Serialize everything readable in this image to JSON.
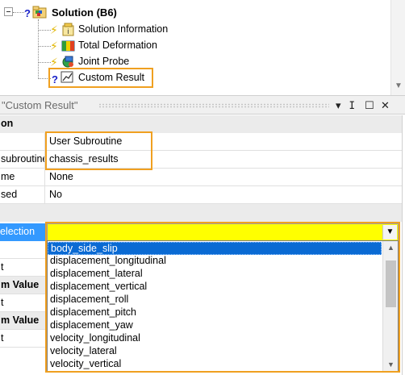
{
  "tree": {
    "root_label": "Solution (B6)",
    "status_mark": "?",
    "children": [
      {
        "label": "Solution Information",
        "icon": "solution-information-icon"
      },
      {
        "label": "Total Deformation",
        "icon": "deformation-result-icon"
      },
      {
        "label": "Joint Probe",
        "icon": "probe-icon"
      },
      {
        "label": "Custom Result",
        "icon": "custom-result-icon"
      }
    ]
  },
  "details": {
    "title": "\"Custom Result\"",
    "header_icons": {
      "dropdown": "▾",
      "pin": "ⵊ",
      "maximize": "☐",
      "close": "✕"
    },
    "rows": [
      {
        "key": "on",
        "value": "",
        "group": true
      },
      {
        "key": "",
        "value": "User Subroutine"
      },
      {
        "key": "subroutine",
        "value": "chassis_results"
      },
      {
        "key": "me",
        "value": "None"
      },
      {
        "key": "sed",
        "value": "No"
      },
      {
        "key": "",
        "value": "",
        "group": true
      }
    ],
    "selection_key": "election",
    "selection_value": "",
    "under_rows": [
      {
        "key": "",
        "bold": false
      },
      {
        "key": "t",
        "bold": false
      },
      {
        "key": "m Value",
        "bold": true
      },
      {
        "key": "t",
        "bold": false
      },
      {
        "key": "m Value",
        "bold": true
      },
      {
        "key": "t",
        "bold": false
      }
    ]
  },
  "dropdown": {
    "options": [
      "body_side_slip",
      "displacement_longitudinal",
      "displacement_lateral",
      "displacement_vertical",
      "displacement_roll",
      "displacement_pitch",
      "displacement_yaw",
      "velocity_longitudinal",
      "velocity_lateral",
      "velocity_vertical"
    ],
    "selected_index": 0
  },
  "colors": {
    "highlight_orange": "#f0a020",
    "selection_yellow": "#ffff00",
    "selection_blue": "#3399ff",
    "list_selected": "#0a6ad3"
  }
}
